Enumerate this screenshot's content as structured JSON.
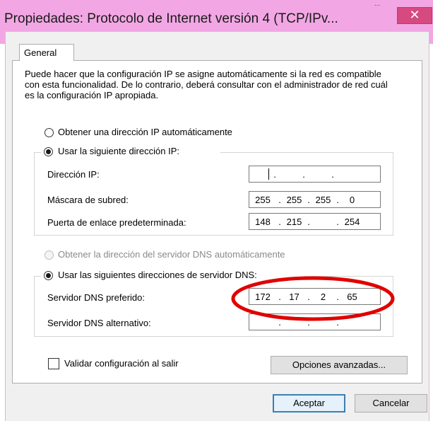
{
  "window": {
    "title": "Propiedades: Protocolo de Internet versión 4 (TCP/IPv...",
    "corner_text": "...",
    "close_glyph": "✕"
  },
  "tabs": [
    {
      "label": "General"
    }
  ],
  "description": "Puede hacer que la configuración IP se asigne automáticamente si la red es compatible con esta funcionalidad. De lo contrario, deberá consultar con el administrador de red cuál es la configuración IP apropiada.",
  "ip_mode": {
    "auto_label": "Obtener una dirección IP automáticamente",
    "manual_label": "Usar la siguiente dirección IP:",
    "selected": "manual"
  },
  "ip_fields": {
    "address": {
      "label": "Dirección IP:",
      "octets": [
        "",
        "",
        "",
        ""
      ]
    },
    "mask": {
      "label": "Máscara de subred:",
      "octets": [
        "255",
        "255",
        "255",
        "0"
      ]
    },
    "gateway": {
      "label": "Puerta de enlace predeterminada:",
      "octets": [
        "148",
        "215",
        "",
        "254"
      ]
    }
  },
  "dns_mode": {
    "auto_label": "Obtener la dirección del servidor DNS automáticamente",
    "manual_label": "Usar las siguientes direcciones de servidor DNS:",
    "selected": "manual",
    "auto_enabled": false
  },
  "dns_fields": {
    "preferred": {
      "label": "Servidor DNS preferido:",
      "octets": [
        "172",
        "17",
        "2",
        "65"
      ]
    },
    "alternate": {
      "label": "Servidor DNS alternativo:",
      "octets": [
        "",
        "",
        "",
        ""
      ]
    }
  },
  "validate": {
    "label": "Validar configuración al salir",
    "checked": false
  },
  "buttons": {
    "advanced": "Opciones avanzadas...",
    "ok": "Aceptar",
    "cancel": "Cancelar"
  },
  "colors": {
    "titlebar": "#f2a7e4",
    "close_button": "#d74a7f",
    "annotation_circle": "#e00000",
    "default_button_border": "#3c7fb1"
  }
}
